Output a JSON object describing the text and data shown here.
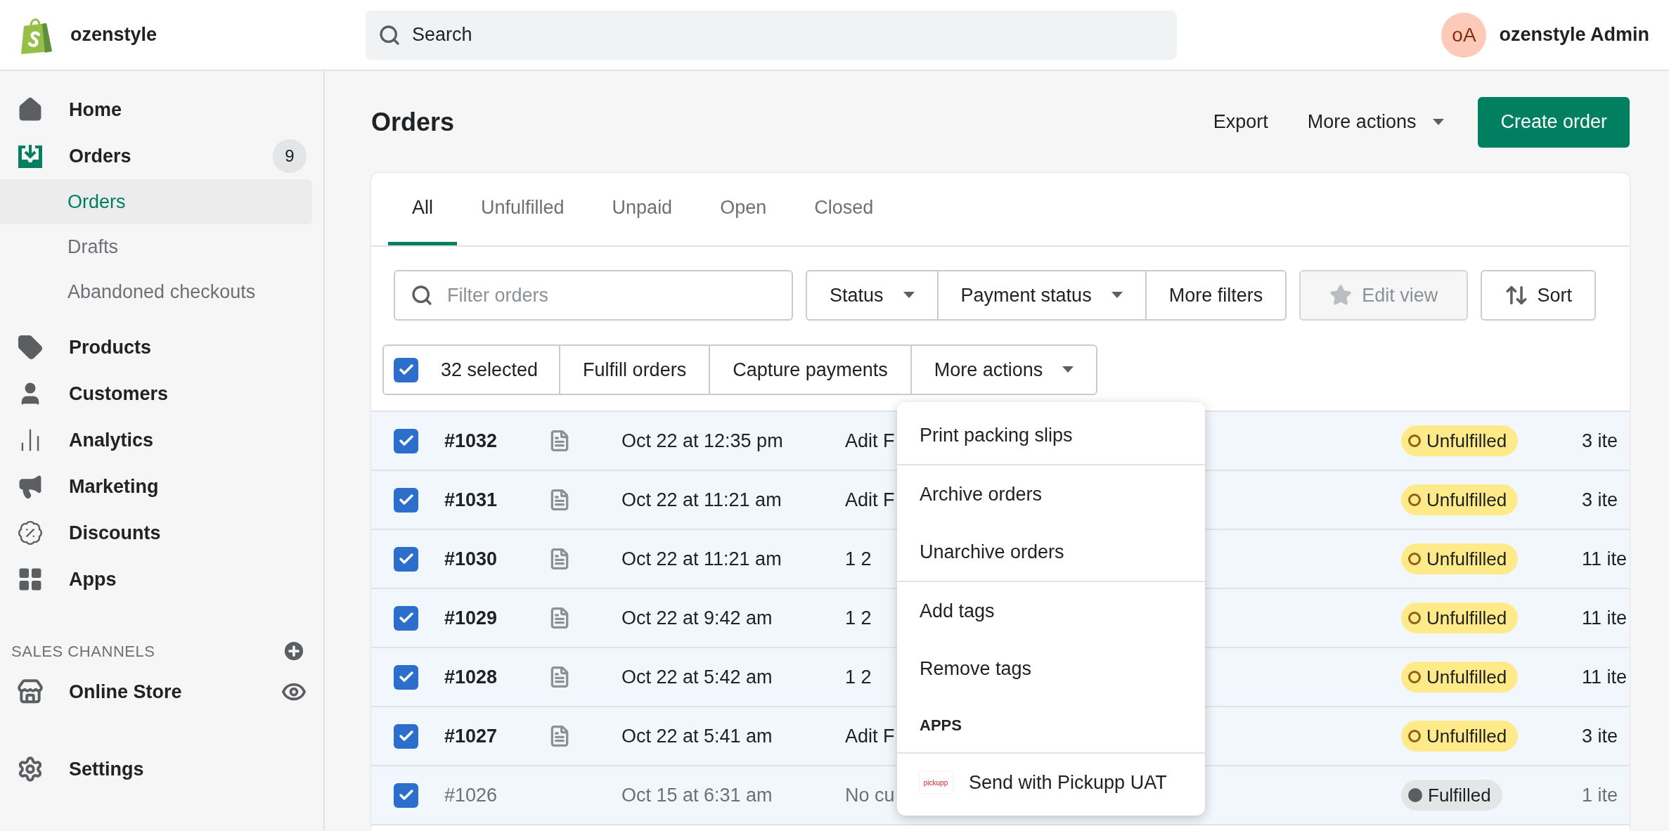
{
  "top_bar": {
    "store_name": "ozenstyle",
    "search_placeholder": "Search",
    "user": {
      "initials": "oA",
      "name": "ozenstyle Admin"
    }
  },
  "sidebar": {
    "items": [
      {
        "label": "Home",
        "selected": false
      },
      {
        "label": "Orders",
        "selected": true,
        "badge": "9",
        "children": [
          {
            "label": "Orders",
            "selected": true
          },
          {
            "label": "Drafts",
            "selected": false
          },
          {
            "label": "Abandoned checkouts",
            "selected": false
          }
        ]
      },
      {
        "label": "Products",
        "selected": false
      },
      {
        "label": "Customers",
        "selected": false
      },
      {
        "label": "Analytics",
        "selected": false
      },
      {
        "label": "Marketing",
        "selected": false
      },
      {
        "label": "Discounts",
        "selected": false
      },
      {
        "label": "Apps",
        "selected": false
      }
    ],
    "sales_channels": {
      "heading": "SALES CHANNELS",
      "items": [
        {
          "label": "Online Store"
        }
      ]
    },
    "settings": "Settings"
  },
  "page": {
    "title": "Orders",
    "secondary_actions": [
      {
        "label": "Export",
        "dropdown": false
      },
      {
        "label": "More actions",
        "dropdown": true
      }
    ],
    "primary_action": "Create order"
  },
  "tabs": [
    {
      "label": "All",
      "selected": true
    },
    {
      "label": "Unfulfilled",
      "selected": false
    },
    {
      "label": "Unpaid",
      "selected": false
    },
    {
      "label": "Open",
      "selected": false
    },
    {
      "label": "Closed",
      "selected": false
    }
  ],
  "filters": {
    "search_placeholder": "Filter orders",
    "buttons": [
      {
        "label": "Status",
        "dropdown": true
      },
      {
        "label": "Payment status",
        "dropdown": true
      },
      {
        "label": "More filters",
        "dropdown": false
      }
    ],
    "edit_view": {
      "label": "Edit view",
      "disabled": true
    },
    "sort": "Sort"
  },
  "bulk_actions": {
    "checked": true,
    "selected_label": "32 selected",
    "actions": [
      {
        "label": "Fulfill orders",
        "dropdown": false
      },
      {
        "label": "Capture payments",
        "dropdown": false
      },
      {
        "label": "More actions",
        "dropdown": true
      }
    ]
  },
  "rows": [
    {
      "order": "#1032",
      "checked": true,
      "note": true,
      "archived": false,
      "date": "Oct 22 at 12:35 pm",
      "customer": "Adit F",
      "fulfillment": {
        "label": "Unfulfilled",
        "kind": "unfulfilled"
      },
      "items": "3 ite"
    },
    {
      "order": "#1031",
      "checked": true,
      "note": true,
      "archived": false,
      "date": "Oct 22 at 11:21 am",
      "customer": "Adit F",
      "fulfillment": {
        "label": "Unfulfilled",
        "kind": "unfulfilled"
      },
      "items": "3 ite"
    },
    {
      "order": "#1030",
      "checked": true,
      "note": true,
      "archived": false,
      "date": "Oct 22 at 11:21 am",
      "customer": "1 2",
      "fulfillment": {
        "label": "Unfulfilled",
        "kind": "unfulfilled"
      },
      "items": "11 ite"
    },
    {
      "order": "#1029",
      "checked": true,
      "note": true,
      "archived": false,
      "date": "Oct 22 at 9:42 am",
      "customer": "1 2",
      "fulfillment": {
        "label": "Unfulfilled",
        "kind": "unfulfilled"
      },
      "items": "11 ite"
    },
    {
      "order": "#1028",
      "checked": true,
      "note": true,
      "archived": false,
      "date": "Oct 22 at 5:42 am",
      "customer": "1 2",
      "fulfillment": {
        "label": "Unfulfilled",
        "kind": "unfulfilled"
      },
      "items": "11 ite"
    },
    {
      "order": "#1027",
      "checked": true,
      "note": true,
      "archived": false,
      "date": "Oct 22 at 5:41 am",
      "customer": "Adit F",
      "fulfillment": {
        "label": "Unfulfilled",
        "kind": "unfulfilled"
      },
      "items": "3 ite"
    },
    {
      "order": "#1026",
      "checked": true,
      "note": false,
      "archived": true,
      "date": "Oct 15 at 6:31 am",
      "customer": "No cu",
      "fulfillment": {
        "label": "Fulfilled",
        "kind": "fulfilled"
      },
      "items": "1 ite"
    }
  ],
  "menu": {
    "sections": [
      [
        {
          "kind": "action",
          "label": "Print packing slips"
        }
      ],
      [
        {
          "kind": "action",
          "label": "Archive orders"
        },
        {
          "kind": "action",
          "label": "Unarchive orders"
        }
      ],
      [
        {
          "kind": "action",
          "label": "Add tags"
        },
        {
          "kind": "action",
          "label": "Remove tags"
        },
        {
          "kind": "heading",
          "label": "APPS"
        }
      ],
      [
        {
          "kind": "app",
          "label": "Send with Pickupp UAT",
          "logo_text": "pickupp"
        }
      ]
    ]
  }
}
